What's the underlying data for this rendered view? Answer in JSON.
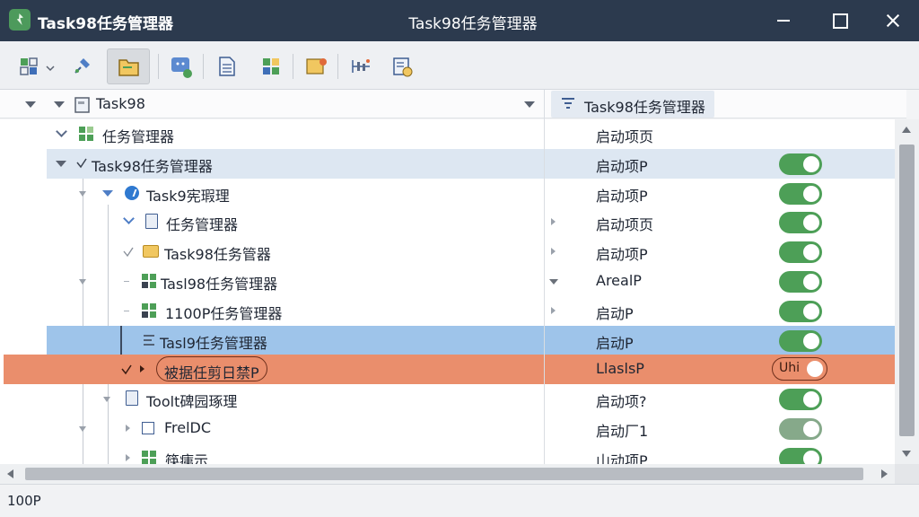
{
  "window": {
    "title_left": "Task98任务管理器",
    "title_center": "Task98任务管理器"
  },
  "toolbar": {
    "buttons": [
      {
        "icon": "layout-icon",
        "name": "view-layout"
      },
      {
        "icon": "pin-icon",
        "name": "pin"
      },
      {
        "icon": "folder-open-icon",
        "name": "open-folder",
        "active": true
      },
      {
        "icon": "monitor-icon",
        "name": "monitor"
      },
      {
        "icon": "document-icon",
        "name": "document"
      },
      {
        "icon": "grid-icon",
        "name": "grid"
      },
      {
        "icon": "tag-icon",
        "name": "tag"
      },
      {
        "icon": "chart-icon",
        "name": "chart"
      },
      {
        "icon": "settings-doc-icon",
        "name": "settings-doc"
      }
    ]
  },
  "header": {
    "root_label": "Task98",
    "column2_label": "Task98任务管理器"
  },
  "tree": {
    "rows": [
      {
        "label": "任务管理器",
        "value": "启动项页",
        "toggle": null
      },
      {
        "label": "Task98任务管理器",
        "value": "启动项P",
        "toggle": "on"
      },
      {
        "label": "Task9宪瑕理",
        "value": "启动项P",
        "toggle": "on"
      },
      {
        "label": "任务管理器",
        "value": "启动项页",
        "toggle": "on"
      },
      {
        "label": "Task98任务管器",
        "value": "启动项P",
        "toggle": "on"
      },
      {
        "label": "Tasl98任务管理器",
        "value": "ArealP",
        "toggle": "on"
      },
      {
        "label": "1100P任务管理器",
        "value": "启动P",
        "toggle": "on"
      },
      {
        "label": "Tasl​9任务管理器",
        "value": "启动P",
        "toggle": "on"
      },
      {
        "label": "被据任剪日禁P",
        "value": "LlaslsP",
        "toggle": "Uhi"
      },
      {
        "label": "Toolt碑园琢理",
        "value": "启动项?",
        "toggle": "on"
      },
      {
        "label": "FrelDC",
        "value": "启动厂1",
        "toggle": "dim"
      },
      {
        "label": "筷痍示",
        "value": "山动项P",
        "toggle": "on"
      }
    ]
  },
  "status": {
    "text": "100P"
  },
  "colors": {
    "titlebar": "#2c3a4e",
    "toggle_on": "#4d9f57",
    "selection_blue": "#9ec4ea",
    "error_row": "#ea8e6c"
  }
}
